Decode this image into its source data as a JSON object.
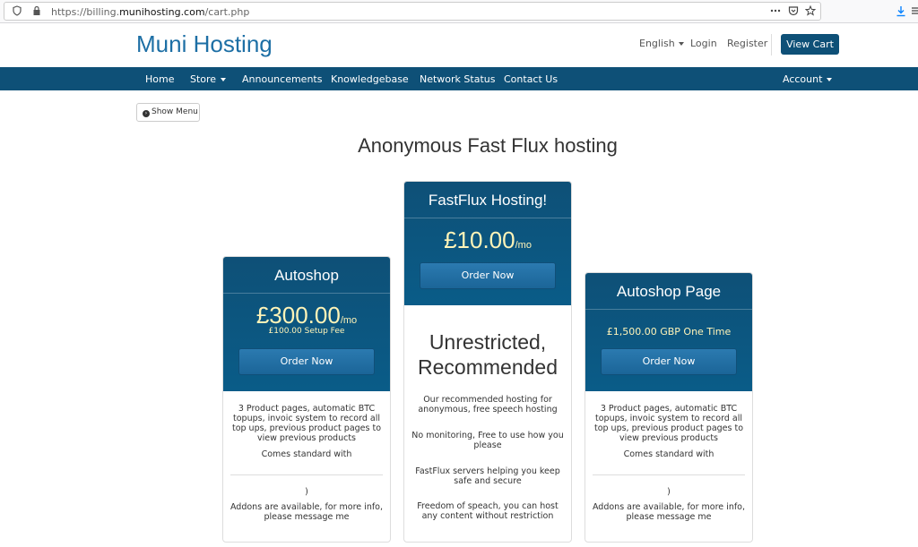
{
  "browser": {
    "url_prefix": "https://billing.",
    "url_domain": "munihosting.com",
    "url_path": "/cart.php",
    "icons": [
      "shield-icon",
      "lock-icon",
      "more-icon",
      "pocket-icon",
      "star-icon",
      "download-icon",
      "menu-icon"
    ]
  },
  "header": {
    "brand": "Muni Hosting",
    "language": "English",
    "login": "Login",
    "register": "Register",
    "view_cart": "View Cart"
  },
  "nav": {
    "items": [
      "Home",
      "Store",
      "Announcements",
      "Knowledgebase",
      "Network Status",
      "Contact Us"
    ],
    "account": "Account"
  },
  "show_menu": "Show Menu",
  "page_title": "Anonymous Fast Flux hosting",
  "cards": {
    "autoshop": {
      "title": "Autoshop",
      "price": "£300.00",
      "period": "/mo",
      "setup": "£100.00 Setup Fee",
      "order": "Order Now",
      "feature1": "3 Product pages, automatic BTC topups, invoic system to record all top ups, previous product pages to view previous products",
      "feature2": "Comes standard with",
      "feature3": ")",
      "feature4": "Addons are available, for more info, please message me"
    },
    "fastflux": {
      "title": "FastFlux Hosting!",
      "price": "£10.00",
      "period": "/mo",
      "order": "Order Now",
      "headline": "Unrestricted, Recommended",
      "feature1": "Our recommended hosting for anonymous, free speech hosting",
      "feature2": "No monitoring, Free to use how you please",
      "feature3": "FastFlux servers helping you keep safe and secure",
      "feature4": "Freedom of speach, you can host any content without restriction"
    },
    "autoshop_page": {
      "title": "Autoshop Page",
      "price": "£1,500.00 GBP One Time",
      "order": "Order Now",
      "feature1": "3 Product pages, automatic BTC topups, invoic system to record all top ups, previous product pages to view previous products",
      "feature2": "Comes standard with",
      "feature3": ")",
      "feature4": "Addons are available, for more info, please message me"
    }
  },
  "colors": {
    "brand_blue": "#1d6fa5",
    "nav_bg": "#0e5077",
    "price_yellow": "#fff4b8"
  }
}
